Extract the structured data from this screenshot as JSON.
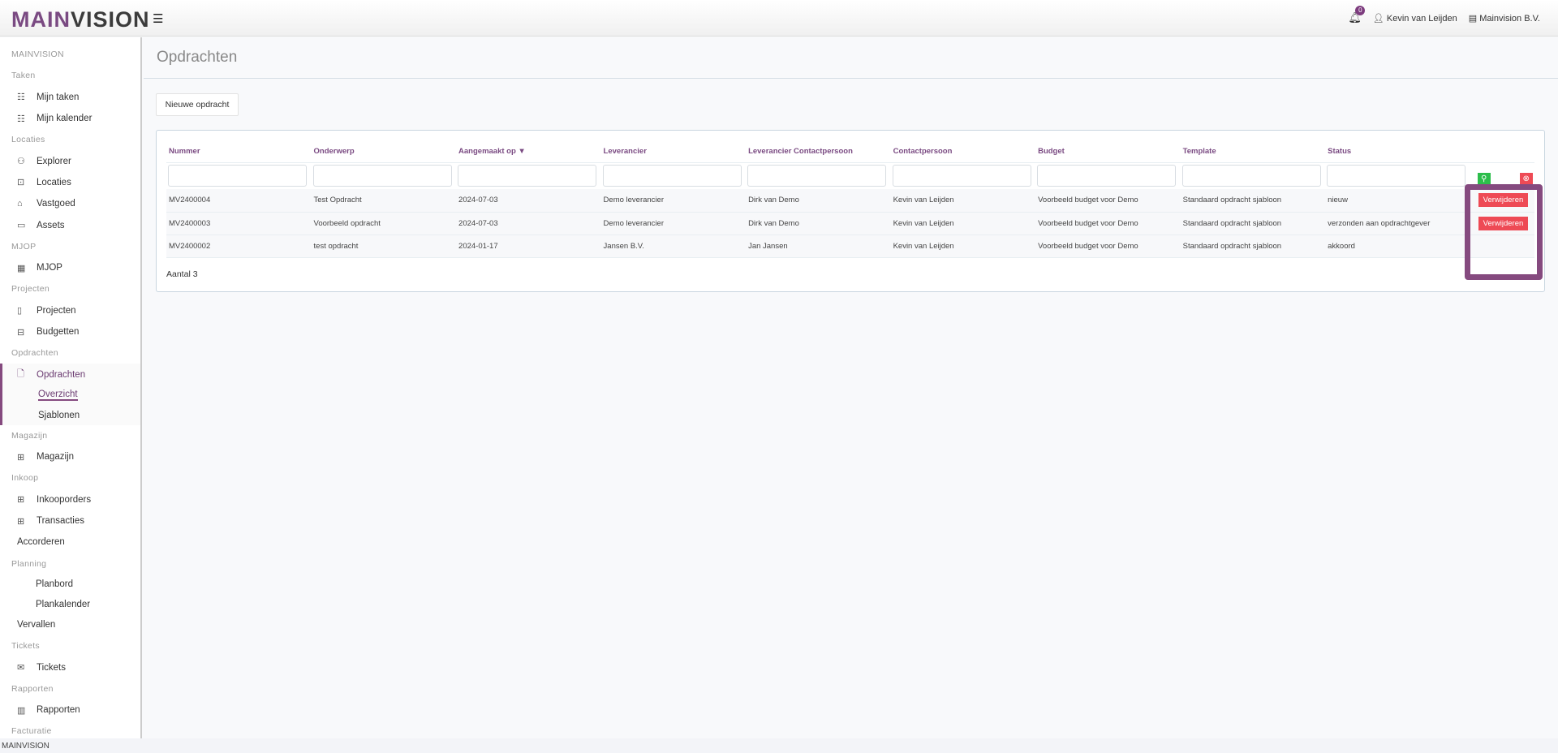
{
  "header": {
    "logo_a": "MAIN",
    "logo_b": "VISION",
    "notifications": "0",
    "user": "Kevin van Leijden",
    "company": "Mainvision B.V."
  },
  "sidebar": [
    {
      "t": "sec",
      "label": "MAINVISION"
    },
    {
      "t": "sec",
      "label": "Taken"
    },
    {
      "t": "item",
      "label": "Mijn taken",
      "icon": "list-icon",
      "g": "☷"
    },
    {
      "t": "item",
      "label": "Mijn kalender",
      "icon": "list-icon",
      "g": "☷"
    },
    {
      "t": "sec",
      "label": "Locaties"
    },
    {
      "t": "item",
      "label": "Explorer",
      "icon": "sitemap-icon",
      "g": "⚇"
    },
    {
      "t": "item",
      "label": "Locaties",
      "icon": "briefcase-icon",
      "g": "⊡"
    },
    {
      "t": "item",
      "label": "Vastgoed",
      "icon": "home-icon",
      "g": "⌂"
    },
    {
      "t": "item",
      "label": "Assets",
      "icon": "folder-icon",
      "g": "▭"
    },
    {
      "t": "sec",
      "label": "MJOP"
    },
    {
      "t": "item",
      "label": "MJOP",
      "icon": "calendar-icon",
      "g": "▦"
    },
    {
      "t": "sec",
      "label": "Projecten"
    },
    {
      "t": "item",
      "label": "Projecten",
      "icon": "book-icon",
      "g": "▯"
    },
    {
      "t": "item",
      "label": "Budgetten",
      "icon": "ledger-icon",
      "g": "⊟"
    },
    {
      "t": "sec",
      "label": "Opdrachten"
    },
    {
      "t": "active",
      "label": "Opdrachten",
      "icon": "file-icon",
      "g": "🗋",
      "subs": [
        {
          "label": "Overzicht",
          "sel": true
        },
        {
          "label": "Sjablonen"
        }
      ]
    },
    {
      "t": "sec",
      "label": "Magazijn"
    },
    {
      "t": "item",
      "label": "Magazijn",
      "icon": "grid-icon",
      "g": "⊞"
    },
    {
      "t": "sec",
      "label": "Inkoop"
    },
    {
      "t": "item",
      "label": "Inkooporders",
      "icon": "grid-icon",
      "g": "⊞"
    },
    {
      "t": "item",
      "label": "Transacties",
      "icon": "grid-icon",
      "g": "⊞"
    },
    {
      "t": "noic",
      "label": "Accorderen"
    },
    {
      "t": "sec",
      "label": "Planning"
    },
    {
      "t": "sub",
      "label": "Planbord"
    },
    {
      "t": "sub",
      "label": "Plankalender"
    },
    {
      "t": "noic",
      "label": "Vervallen"
    },
    {
      "t": "sec",
      "label": "Tickets"
    },
    {
      "t": "item",
      "label": "Tickets",
      "icon": "envelope-open-icon",
      "g": "✉"
    },
    {
      "t": "sec",
      "label": "Rapporten"
    },
    {
      "t": "item",
      "label": "Rapporten",
      "icon": "report-book-icon",
      "g": "▥"
    },
    {
      "t": "sec",
      "label": "Facturatie"
    }
  ],
  "footer": "MAINVISION",
  "page": {
    "title": "Opdrachten",
    "new_button": "Nieuwe opdracht",
    "count": "Aantal 3",
    "delete_label": "Verwijderen"
  },
  "table": {
    "columns": [
      "Nummer",
      "Onderwerp",
      "Aangemaakt op ▼",
      "Leverancier",
      "Leverancier Contactpersoon",
      "Contactpersoon",
      "Budget",
      "Template",
      "Status"
    ],
    "rows": [
      {
        "cells": [
          "MV2400004",
          "Test Opdracht",
          "2024-07-03",
          "Demo leverancier",
          "Dirk van Demo",
          "Kevin van Leijden",
          "Voorbeeld budget voor Demo",
          "Standaard opdracht sjabloon",
          "nieuw"
        ],
        "deletable": true
      },
      {
        "cells": [
          "MV2400003",
          "Voorbeeld opdracht",
          "2024-07-03",
          "Demo leverancier",
          "Dirk van Demo",
          "Kevin van Leijden",
          "Voorbeeld budget voor Demo",
          "Standaard opdracht sjabloon",
          "verzonden aan opdrachtgever"
        ],
        "deletable": true
      },
      {
        "cells": [
          "MV2400002",
          "test opdracht",
          "2024-01-17",
          "Jansen B.V.",
          "Jan Jansen",
          "Kevin van Leijden",
          "Voorbeeld budget voor Demo",
          "Standaard opdracht sjabloon",
          "akkoord"
        ],
        "deletable": false
      }
    ]
  },
  "colors": {
    "accent": "#854a7f",
    "danger": "#ee4a55",
    "success": "#2dbd4b"
  }
}
